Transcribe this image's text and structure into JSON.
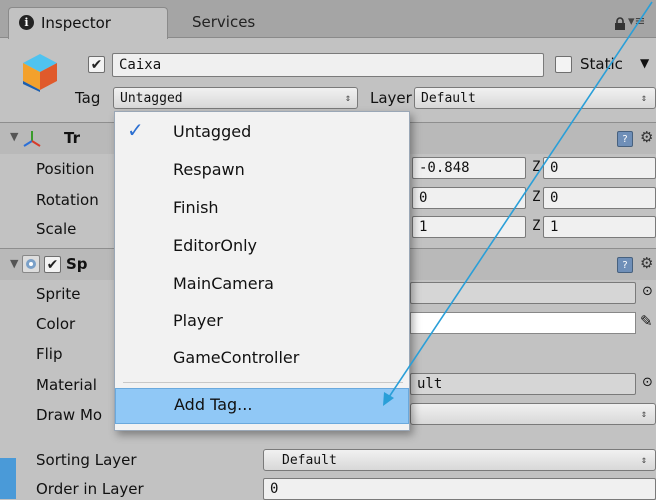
{
  "tabs": [
    {
      "label": "Inspector",
      "icon": "info-icon"
    },
    {
      "label": "Services"
    }
  ],
  "object": {
    "active": true,
    "name": "Caixa",
    "static_label": "Static",
    "static_checked": false,
    "tag_label": "Tag",
    "tag_value": "Untagged",
    "layer_label": "Layer",
    "layer_value": "Default"
  },
  "transform": {
    "title": "Tr",
    "rows": [
      {
        "label": "Position",
        "x": "-0.848",
        "z_axis": "Z",
        "z": "0"
      },
      {
        "label": "Rotation",
        "x": "0",
        "z_axis": "Z",
        "z": "0"
      },
      {
        "label": "Scale",
        "x": "1",
        "z_axis": "Z",
        "z": "1"
      }
    ]
  },
  "sprite_renderer": {
    "title": "Sp",
    "enabled": true,
    "rows": [
      "Sprite",
      "Color",
      "Flip",
      "Material",
      "Draw Mo"
    ],
    "material_value": "ult",
    "sorting_layer_label": "Sorting Layer",
    "sorting_layer_value": "Default",
    "order_label": "Order in Layer",
    "order_value": "0"
  },
  "tag_dropdown": {
    "selected": "Untagged",
    "items": [
      "Untagged",
      "Respawn",
      "Finish",
      "EditorOnly",
      "MainCamera",
      "Player",
      "GameController"
    ],
    "add_tag": "Add Tag..."
  },
  "colors": {
    "annotation_line": "#2a9fd8",
    "highlight": "#90c8f6"
  }
}
